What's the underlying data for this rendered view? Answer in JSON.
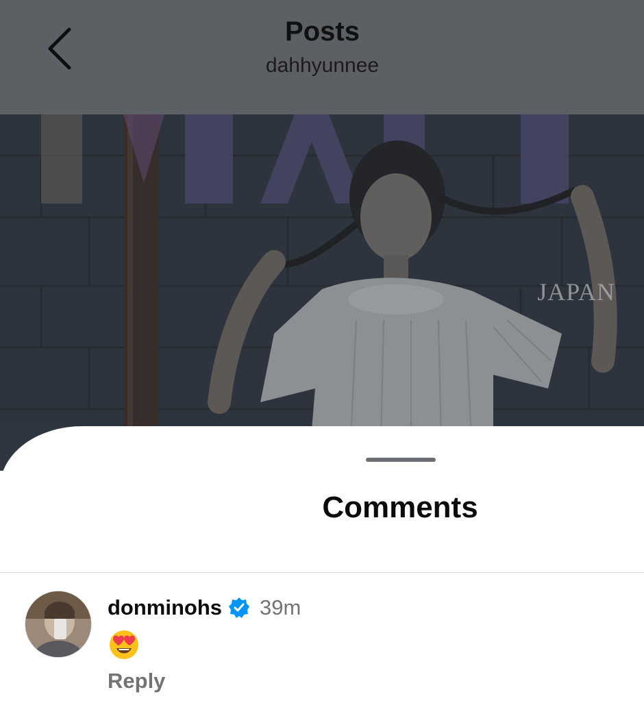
{
  "header": {
    "title": "Posts",
    "subtitle": "dahhyunnee",
    "back_icon": "chevron-left-icon"
  },
  "photo": {
    "badge_text": "JAPAN"
  },
  "comments_sheet": {
    "title": "Comments",
    "comments": [
      {
        "username": "donminohs",
        "verified": true,
        "time": "39m",
        "text": "😍",
        "reply_label": "Reply"
      }
    ]
  },
  "colors": {
    "overlay": "#5c6064",
    "verified_blue": "#0095f6",
    "secondary_text": "#737373"
  }
}
